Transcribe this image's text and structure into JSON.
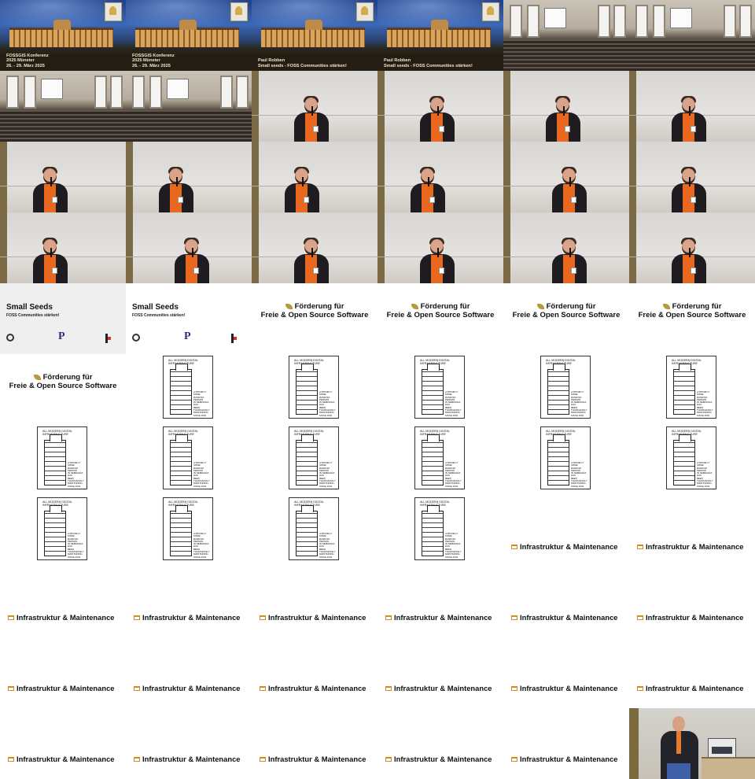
{
  "title_card": {
    "conference_lines": [
      "FOSSGIS Konferenz",
      "2025 Münster",
      "26. - 29. März 2025"
    ],
    "speaker_lines": [
      "Paul Robben",
      "Small seeds - FOSS Communities stärken!"
    ]
  },
  "slides": {
    "small_seeds_title": "Small Seeds",
    "small_seeds_subtitle": "FOSS Communities stärken!",
    "small_seeds_logo_letter": "P",
    "foerderung_line1": "Förderung für",
    "foerderung_line2": "Freie & Open Source Software",
    "xkcd_caption": [
      "ALL MODERN DIGITAL",
      "INFRASTRUCTURE"
    ],
    "xkcd_note": [
      "A PROJECT SOME",
      "RANDOM PERSON",
      "IN NEBRASKA HAS",
      "BEEN THANKLESSLY",
      "MAINTAINING",
      "SINCE 2003"
    ],
    "infra_label": "Infrastruktur & Maintenance"
  },
  "frames": [
    {
      "type": "title",
      "variant": "conf"
    },
    {
      "type": "title",
      "variant": "conf"
    },
    {
      "type": "title",
      "variant": "speaker"
    },
    {
      "type": "title",
      "variant": "speaker"
    },
    {
      "type": "hall"
    },
    {
      "type": "hall"
    },
    {
      "type": "hall"
    },
    {
      "type": "hall"
    },
    {
      "type": "speaker",
      "pos": "right"
    },
    {
      "type": "speaker",
      "pos": "right"
    },
    {
      "type": "speaker",
      "pos": "right"
    },
    {
      "type": "speaker",
      "pos": "right"
    },
    {
      "type": "speaker",
      "pos": "left"
    },
    {
      "type": "speaker",
      "pos": "left"
    },
    {
      "type": "speaker",
      "pos": "left"
    },
    {
      "type": "speaker",
      "pos": "left"
    },
    {
      "type": "speaker",
      "pos": "center"
    },
    {
      "type": "speaker",
      "pos": "right"
    },
    {
      "type": "speaker",
      "pos": "left"
    },
    {
      "type": "speaker",
      "pos": "center"
    },
    {
      "type": "speaker",
      "pos": "right"
    },
    {
      "type": "speaker",
      "pos": "right"
    },
    {
      "type": "speaker",
      "pos": "center"
    },
    {
      "type": "speaker",
      "pos": "right"
    },
    {
      "type": "small_seeds",
      "variant": "gray"
    },
    {
      "type": "small_seeds",
      "variant": "white"
    },
    {
      "type": "foerderung"
    },
    {
      "type": "foerderung"
    },
    {
      "type": "foerderung"
    },
    {
      "type": "foerderung"
    },
    {
      "type": "foerderung"
    },
    {
      "type": "xkcd"
    },
    {
      "type": "xkcd"
    },
    {
      "type": "xkcd"
    },
    {
      "type": "xkcd"
    },
    {
      "type": "xkcd"
    },
    {
      "type": "xkcd"
    },
    {
      "type": "xkcd"
    },
    {
      "type": "xkcd"
    },
    {
      "type": "xkcd"
    },
    {
      "type": "xkcd"
    },
    {
      "type": "xkcd"
    },
    {
      "type": "xkcd"
    },
    {
      "type": "xkcd"
    },
    {
      "type": "xkcd"
    },
    {
      "type": "xkcd"
    },
    {
      "type": "infra"
    },
    {
      "type": "infra"
    },
    {
      "type": "infra"
    },
    {
      "type": "infra"
    },
    {
      "type": "infra"
    },
    {
      "type": "infra"
    },
    {
      "type": "infra"
    },
    {
      "type": "infra"
    },
    {
      "type": "infra"
    },
    {
      "type": "infra"
    },
    {
      "type": "infra"
    },
    {
      "type": "infra"
    },
    {
      "type": "infra"
    },
    {
      "type": "infra"
    },
    {
      "type": "infra"
    },
    {
      "type": "infra"
    },
    {
      "type": "infra"
    },
    {
      "type": "infra"
    },
    {
      "type": "infra"
    },
    {
      "type": "speaker2"
    }
  ]
}
